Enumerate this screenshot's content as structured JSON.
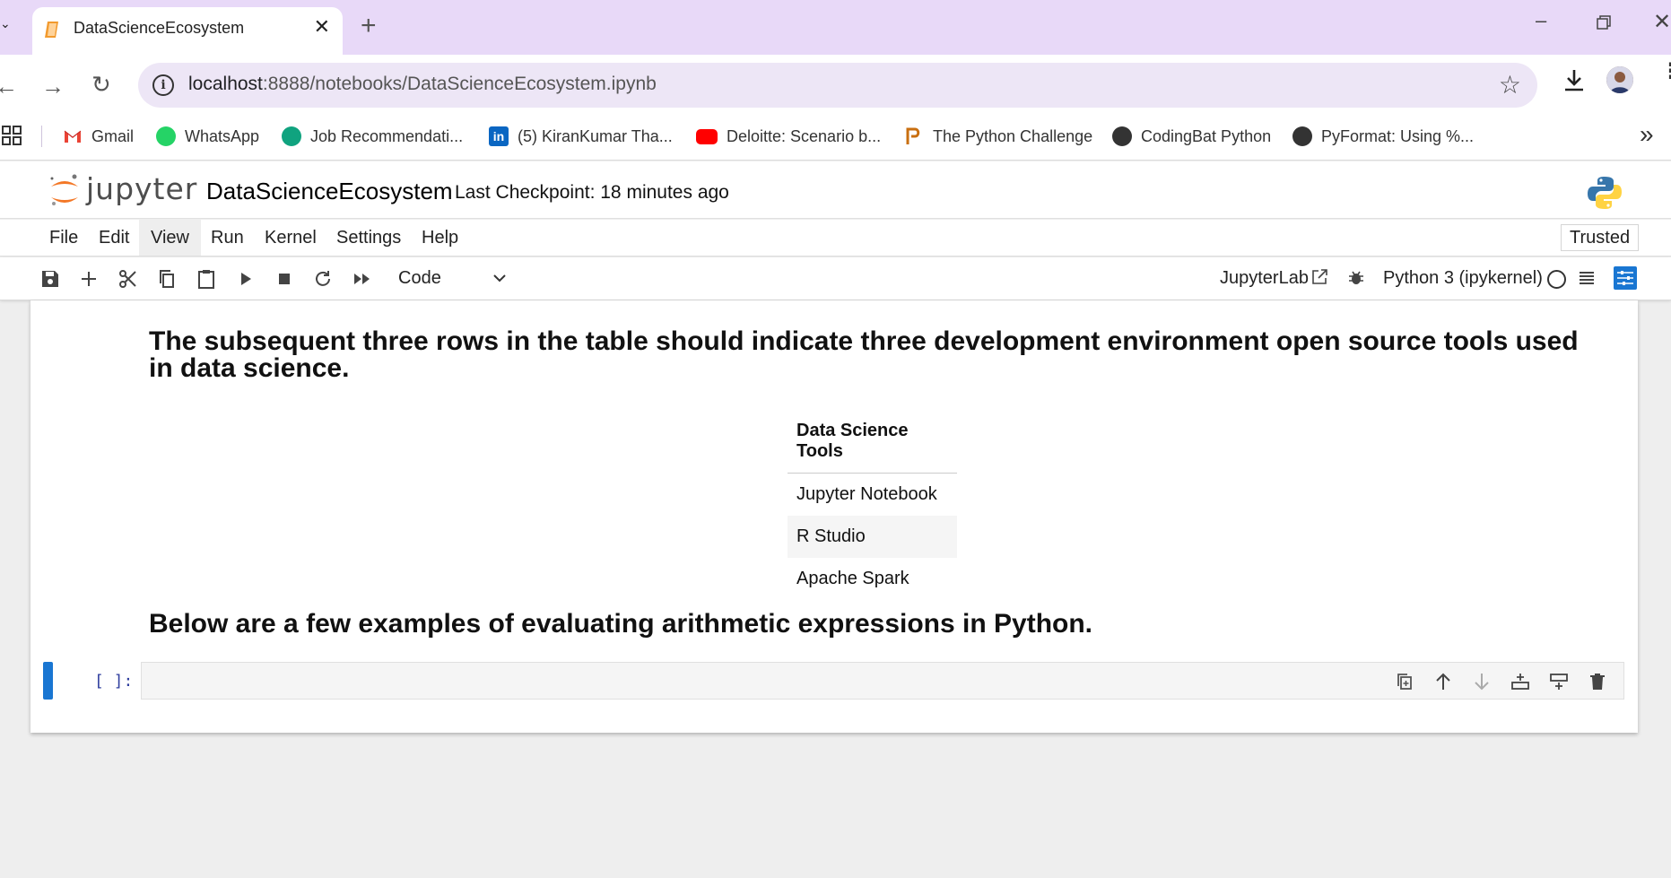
{
  "browser": {
    "tab_title": "DataScienceEcosystem",
    "url_host": "localhost",
    "url_path": ":8888/notebooks/DataScienceEcosystem.ipynb",
    "bookmarks": [
      {
        "label": "Gmail",
        "icon": "gmail-icon",
        "color": "#ea4335"
      },
      {
        "label": "WhatsApp",
        "icon": "whatsapp-icon",
        "color": "#25d366"
      },
      {
        "label": "Job Recommendati...",
        "icon": "chat-icon",
        "color": "#10a37f"
      },
      {
        "label": "(5) KiranKumar Tha...",
        "icon": "linkedin-icon",
        "color": "#0a66c2"
      },
      {
        "label": "Deloitte: Scenario b...",
        "icon": "youtube-icon",
        "color": "#ff0000"
      },
      {
        "label": "The Python Challenge",
        "icon": "python-challenge-icon",
        "color": "#c96f10"
      },
      {
        "label": "CodingBat Python",
        "icon": "globe-icon",
        "color": "#333333"
      },
      {
        "label": "PyFormat: Using %...",
        "icon": "globe-icon",
        "color": "#333333"
      }
    ]
  },
  "jupyter": {
    "wordmark": "jupyter",
    "notebook_name": "DataScienceEcosystem",
    "checkpoint": "Last Checkpoint: 18 minutes ago",
    "menu": [
      "File",
      "Edit",
      "View",
      "Run",
      "Kernel",
      "Settings",
      "Help"
    ],
    "active_menu": "View",
    "trusted": "Trusted",
    "cell_type": "Code",
    "jupyterlab_link": "JupyterLab",
    "kernel_name": "Python 3 (ipykernel)",
    "accent_color": "#1976d2"
  },
  "notebook": {
    "heading_1": "The subsequent three rows in the table should indicate three development environment open source tools used in data science.",
    "table": {
      "header": "Data Science Tools",
      "rows": [
        "Jupyter Notebook",
        "R Studio",
        "Apache Spark"
      ]
    },
    "heading_2": "Below are a few examples of evaluating arithmetic expressions in Python.",
    "code_cell": {
      "prompt": "[ ]:",
      "source": ""
    }
  }
}
